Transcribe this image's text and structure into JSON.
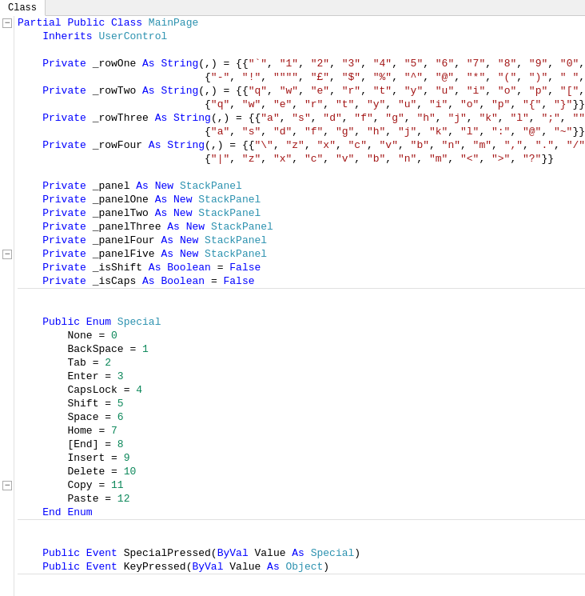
{
  "tab": {
    "label": "Class"
  },
  "status_bar": {
    "left_label": "Class",
    "right_label": ""
  },
  "code": {
    "lines": []
  }
}
